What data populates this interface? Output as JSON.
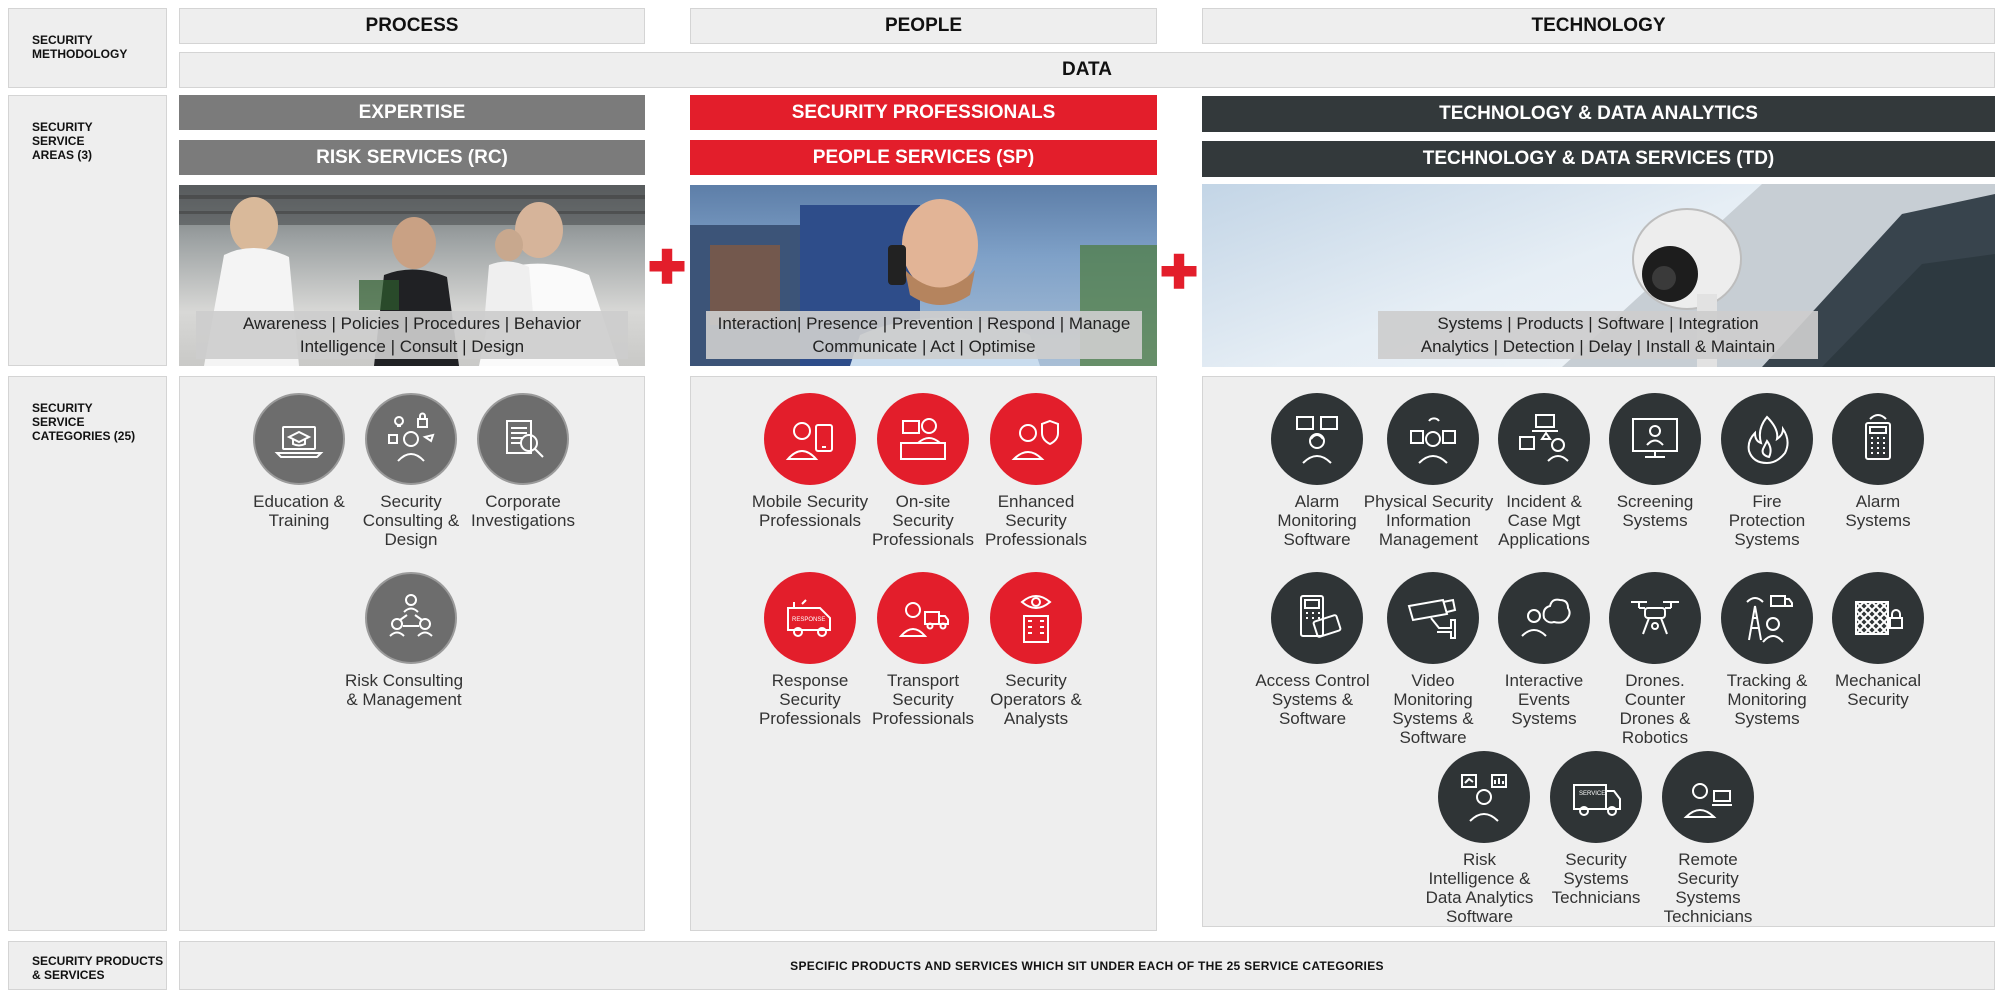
{
  "row_labels": {
    "methodology": "SECURITY\nMETHODOLOGY",
    "areas": "SECURITY\nSERVICE\nAREAS (3)",
    "categories": "SECURITY\nSERVICE\nCATEGORIES (25)",
    "products": "SECURITY PRODUCTS\n& SERVICES"
  },
  "methodology": {
    "process": "PROCESS",
    "people": "PEOPLE",
    "technology": "TECHNOLOGY",
    "data": "DATA"
  },
  "areas": {
    "process": {
      "band1": "EXPERTISE",
      "band2": "RISK SERVICES (RC)",
      "caption_line1": "Awareness | Policies | Procedures | Behavior",
      "caption_line2": "Intelligence | Consult | Design"
    },
    "people": {
      "band1": "SECURITY PROFESSIONALS",
      "band2": "PEOPLE SERVICES (SP)",
      "caption_line1": "Interaction| Presence | Prevention | Respond | Manage",
      "caption_line2": "Communicate | Act | Optimise"
    },
    "technology": {
      "band1": "TECHNOLOGY & DATA ANALYTICS",
      "band2": "TECHNOLOGY & DATA SERVICES (TD)",
      "caption_line1": "Systems | Products | Software | Integration",
      "caption_line2": "Analytics | Detection | Delay | Install & Maintain"
    },
    "plus_symbol": "✚"
  },
  "categories": {
    "process": [
      {
        "name": "Education &\nTraining",
        "icon": "laptop-graduation-cap-icon"
      },
      {
        "name": "Security\nConsulting &\nDesign",
        "icon": "consultant-lightbulb-lock-icon"
      },
      {
        "name": "Corporate\nInvestigations",
        "icon": "document-magnifier-icon"
      },
      {
        "name": "Risk Consulting\n& Management",
        "icon": "people-network-icon"
      }
    ],
    "people": [
      {
        "name": "Mobile Security\nProfessionals",
        "icon": "guard-phone-icon"
      },
      {
        "name": "On-site\nSecurity\nProfessionals",
        "icon": "guard-desk-icon"
      },
      {
        "name": "Enhanced\nSecurity\nProfessionals",
        "icon": "guard-shield-icon"
      },
      {
        "name": "Response\nSecurity\nProfessionals",
        "icon": "response-vehicle-icon"
      },
      {
        "name": "Transport\nSecurity\nProfessionals",
        "icon": "guard-truck-icon"
      },
      {
        "name": "Security\nOperators &\nAnalysts",
        "icon": "eye-building-icon"
      }
    ],
    "technology": [
      {
        "name": "Alarm\nMonitoring\nSoftware",
        "icon": "operator-screens-icon"
      },
      {
        "name": "Physical Security\nInformation\nManagement",
        "icon": "operator-chip-icon"
      },
      {
        "name": "Incident &\nCase Mgt\nApplications",
        "icon": "incident-laptop-icon"
      },
      {
        "name": "Screening\nSystems",
        "icon": "screening-monitor-icon"
      },
      {
        "name": "Fire\nProtection\nSystems",
        "icon": "flame-icon"
      },
      {
        "name": "Alarm\nSystems",
        "icon": "alarm-keypad-icon"
      },
      {
        "name": "Access Control\nSystems &\nSoftware",
        "icon": "access-card-icon"
      },
      {
        "name": "Video\nMonitoring\nSystems &\nSoftware",
        "icon": "cctv-camera-icon"
      },
      {
        "name": "Interactive\nEvents\nSystems",
        "icon": "operator-cloud-icon"
      },
      {
        "name": "Drones.\nCounter\nDrones &\nRobotics",
        "icon": "drone-icon"
      },
      {
        "name": "Tracking &\nMonitoring\nSystems",
        "icon": "tracking-tower-truck-icon"
      },
      {
        "name": "Mechanical\nSecurity",
        "icon": "fence-padlock-icon"
      },
      {
        "name": "Risk\nIntelligence &\nData Analytics\nSoftware",
        "icon": "analyst-charts-icon"
      },
      {
        "name": "Security\nSystems\nTechnicians",
        "icon": "service-van-icon"
      },
      {
        "name": "Remote\nSecurity\nSystems\nTechnicians",
        "icon": "technician-laptop-icon"
      }
    ]
  },
  "footer": "SPECIFIC PRODUCTS AND SERVICES WHICH SIT UNDER EACH OF THE 25 SERVICE CATEGORIES",
  "colors": {
    "red": "#e31e2b",
    "grey": "#7b7b7b",
    "dark": "#33393b"
  }
}
